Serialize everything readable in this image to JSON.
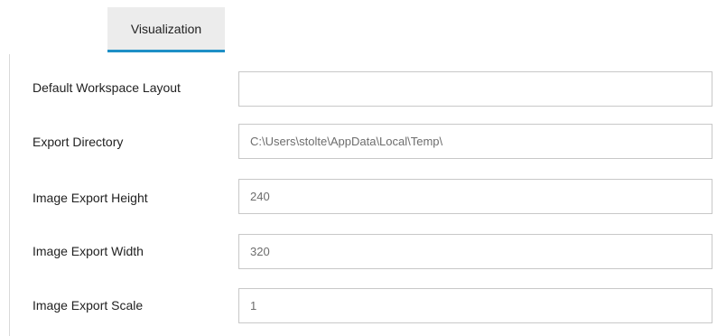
{
  "tab": {
    "label": "Visualization"
  },
  "settings": [
    {
      "label": "Default Workspace Layout",
      "value": ""
    },
    {
      "label": "Export Directory",
      "value": "C:\\Users\\stolte\\AppData\\Local\\Temp\\"
    },
    {
      "label": "Image Export Height",
      "value": "240"
    },
    {
      "label": "Image Export Width",
      "value": "320"
    },
    {
      "label": "Image Export Scale",
      "value": "1"
    }
  ],
  "colors": {
    "tab_background": "#ececec",
    "tab_underline": "#1e8fc6",
    "field_border": "#c8c8c8",
    "value_text": "#6d6d6d"
  }
}
